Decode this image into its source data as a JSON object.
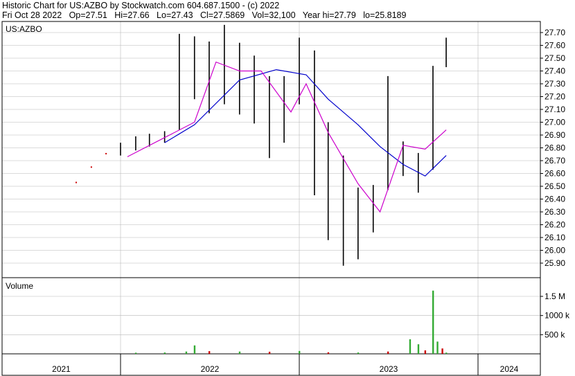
{
  "header": {
    "line1": "Historic Chart for US:AZBO by Stockwatch.com 604.687.1500 - (c) 2022",
    "line2": "Fri Oct 28 2022   Op=27.51   Hi=27.66   Lo=27.43   Cl=27.5869   Vol=32,100   Year hi=27.79   lo=25.8189"
  },
  "colors": {
    "price_bars": "#000000",
    "ma_short": "#cc00cc",
    "ma_long": "#0000cc",
    "volume_up": "#33aa33",
    "volume_down": "#cc0000",
    "pre_history_dots": "#cc0000",
    "grid": "#b8b8b8"
  },
  "chart_data": [
    {
      "type": "line",
      "panel": "price",
      "title": "US:AZBO",
      "ylim": [
        25.8,
        27.8
      ],
      "yticks": [
        "27.70",
        "27.60",
        "27.50",
        "27.40",
        "27.30",
        "27.20",
        "27.10",
        "27.00",
        "26.90",
        "26.80",
        "26.70",
        "26.60",
        "26.50",
        "26.40",
        "26.30",
        "26.20",
        "26.10",
        "26.00",
        "25.90"
      ],
      "x_axis": [
        "2021",
        "2022",
        "2023",
        "2024"
      ],
      "series": [
        {
          "style": "ohlc-bars",
          "x": [
            "2020-10-01",
            "2020-11-01",
            "2020-12-01",
            "2021-01-01",
            "2021-02-01",
            "2021-03-01",
            "2021-04-01",
            "2021-05-01",
            "2021-06-01",
            "2021-07-01",
            "2021-08-01",
            "2021-09-01",
            "2021-10-01",
            "2021-11-01",
            "2021-12-01",
            "2022-01-01",
            "2022-02-01",
            "2022-03-01",
            "2022-04-01",
            "2022-05-01",
            "2022-06-01",
            "2022-07-01",
            "2022-08-01",
            "2022-09-01",
            "2022-10-01",
            "2022-10-28"
          ],
          "high": [
            26.62,
            26.73,
            26.8,
            26.84,
            26.89,
            26.91,
            26.93,
            27.69,
            27.67,
            27.63,
            27.76,
            27.62,
            27.52,
            27.36,
            27.36,
            27.66,
            27.56,
            27.0,
            26.74,
            26.49,
            26.51,
            27.36,
            26.85,
            26.76,
            27.44,
            27.66
          ],
          "low": [
            26.45,
            26.58,
            26.72,
            26.74,
            26.78,
            26.81,
            26.84,
            26.94,
            27.18,
            27.07,
            27.14,
            27.06,
            26.99,
            26.72,
            26.84,
            27.14,
            26.43,
            26.08,
            25.88,
            25.93,
            26.14,
            26.47,
            26.58,
            26.45,
            26.63,
            27.43
          ]
        },
        {
          "style": "moving-average-short",
          "x": [
            "2021-01-15",
            "2021-04-01",
            "2021-06-01",
            "2021-07-15",
            "2021-09-01",
            "2021-10-15",
            "2021-12-15",
            "2022-01-15",
            "2022-03-01",
            "2022-05-01",
            "2022-06-15",
            "2022-08-01",
            "2022-09-15",
            "2022-10-28"
          ],
          "y": [
            26.73,
            26.88,
            27.0,
            27.47,
            27.4,
            27.4,
            27.08,
            27.3,
            26.92,
            26.52,
            26.3,
            26.82,
            26.79,
            26.94
          ]
        },
        {
          "style": "moving-average-long",
          "x": [
            "2021-04-01",
            "2021-06-01",
            "2021-09-01",
            "2021-11-15",
            "2022-01-15",
            "2022-03-01",
            "2022-05-01",
            "2022-06-15",
            "2022-08-01",
            "2022-09-15",
            "2022-10-28"
          ],
          "y": [
            26.84,
            26.98,
            27.33,
            27.41,
            27.37,
            27.18,
            26.98,
            26.81,
            26.67,
            26.58,
            26.74
          ]
        }
      ]
    },
    {
      "type": "bar",
      "panel": "volume",
      "title": "Volume",
      "yticks": [
        "1.5 M",
        "1000 k",
        "500 k"
      ],
      "ylim": [
        0,
        1800000
      ],
      "x_axis": [
        "2021",
        "2022",
        "2023",
        "2024"
      ],
      "x": [
        "2021-02-01",
        "2021-04-01",
        "2021-05-15",
        "2021-06-01",
        "2021-07-01",
        "2021-09-01",
        "2021-11-01",
        "2022-01-01",
        "2022-03-01",
        "2022-05-01",
        "2022-07-01",
        "2022-08-15",
        "2022-09-01",
        "2022-09-15",
        "2022-10-01",
        "2022-10-10",
        "2022-10-20",
        "2022-10-28"
      ],
      "values": [
        30000,
        35000,
        60000,
        220000,
        70000,
        60000,
        55000,
        75000,
        40000,
        35000,
        60000,
        380000,
        250000,
        90000,
        1650000,
        320000,
        140000,
        32100
      ],
      "colors": [
        "up",
        "up",
        "up",
        "up",
        "down",
        "up",
        "down",
        "up",
        "down",
        "up",
        "down",
        "up",
        "up",
        "down",
        "up",
        "up",
        "down",
        "up"
      ]
    }
  ]
}
